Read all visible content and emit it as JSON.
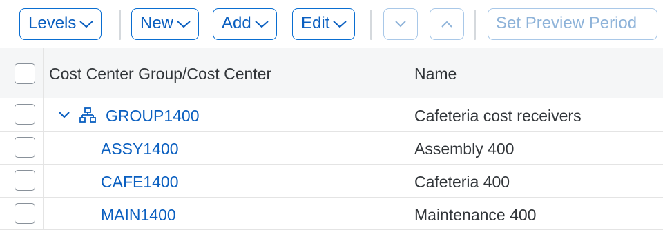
{
  "toolbar": {
    "levels_label": "Levels",
    "new_label": "New",
    "add_label": "Add",
    "edit_label": "Edit",
    "set_preview_label": "Set Preview Period",
    "move_down_icon": "chevron-down-icon",
    "move_up_icon": "chevron-up-icon"
  },
  "table": {
    "columns": [
      "Cost Center Group/Cost Center",
      "Name"
    ],
    "rows": [
      {
        "id": "GROUP1400",
        "name": "Cafeteria cost receivers",
        "type": "group",
        "expanded": true
      },
      {
        "id": "ASSY1400",
        "name": "Assembly 400",
        "type": "cost-center"
      },
      {
        "id": "CAFE1400",
        "name": "Cafeteria 400",
        "type": "cost-center"
      },
      {
        "id": "MAIN1400",
        "name": "Maintenance 400",
        "type": "cost-center"
      }
    ]
  },
  "colors": {
    "accent": "#0a6ed1",
    "link": "#0a5fc0",
    "disabled": "#8eb3d9",
    "header_bg": "#f5f6f7"
  }
}
